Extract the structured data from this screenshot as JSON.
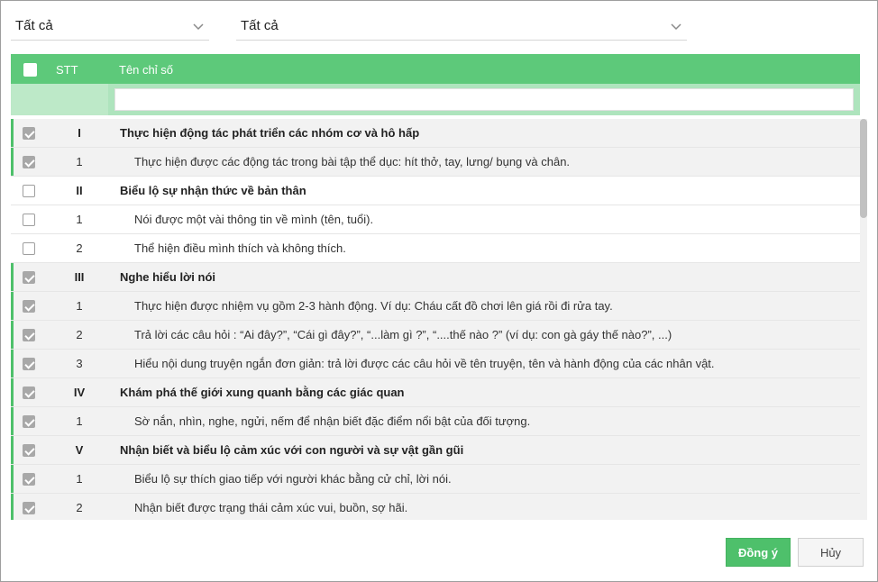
{
  "filters": {
    "first": {
      "value": "Tất cả"
    },
    "second": {
      "value": "Tất cả"
    }
  },
  "table": {
    "columns": {
      "stt": "STT",
      "name": "Tên chỉ số"
    },
    "filter_placeholder": "",
    "rows": [
      {
        "stt": "I",
        "name": "Thực hiện động tác phát triển các nhóm cơ và hô hấp",
        "group": true,
        "checked": true
      },
      {
        "stt": "1",
        "name": "Thực hiện được các động tác trong bài tập thể dục: hít thở, tay, lưng/ bụng và chân.",
        "group": false,
        "checked": true
      },
      {
        "stt": "II",
        "name": "Biểu lộ sự nhận thức về bản thân",
        "group": true,
        "checked": false
      },
      {
        "stt": "1",
        "name": "Nói được một vài thông tin về mình (tên, tuổi).",
        "group": false,
        "checked": false
      },
      {
        "stt": "2",
        "name": "Thể hiện điều mình thích và không thích.",
        "group": false,
        "checked": false
      },
      {
        "stt": "III",
        "name": "Nghe hiểu lời nói",
        "group": true,
        "checked": true
      },
      {
        "stt": "1",
        "name": "Thực hiện được nhiệm vụ gồm 2-3 hành động. Ví dụ: Cháu cất đồ chơi lên giá rồi đi rửa tay.",
        "group": false,
        "checked": true
      },
      {
        "stt": "2",
        "name": "Trả lời các câu hỏi : “Ai đây?”, “Cái gì đây?”, “...làm gì ?”, “....thế nào ?” (ví dụ: con gà gáy thế nào?”, ...)",
        "group": false,
        "checked": true
      },
      {
        "stt": "3",
        "name": "Hiểu nội dung truyện ngắn đơn giản: trả lời được các câu hỏi về tên truyện, tên và hành động của các nhân vật.",
        "group": false,
        "checked": true
      },
      {
        "stt": "IV",
        "name": "Khám phá thế giới xung quanh bằng các giác quan",
        "group": true,
        "checked": true
      },
      {
        "stt": "1",
        "name": "Sờ nắn, nhìn, nghe, ngửi, nếm để nhận biết đặc điểm nổi bật của đối tượng.",
        "group": false,
        "checked": true
      },
      {
        "stt": "V",
        "name": "Nhận biết và biểu lộ cảm xúc với con người và sự vật gần gũi",
        "group": true,
        "checked": true
      },
      {
        "stt": "1",
        "name": "Biểu lộ sự thích giao tiếp với người khác bằng cử chỉ, lời nói.",
        "group": false,
        "checked": true
      },
      {
        "stt": "2",
        "name": "Nhận biết được trạng thái cảm xúc vui, buồn, sợ hãi.",
        "group": false,
        "checked": true
      }
    ]
  },
  "buttons": {
    "ok": "Đồng ý",
    "cancel": "Hủy"
  },
  "colors": {
    "accent": "#5dc97a",
    "selected_bar": "#4ec06b",
    "checked_box": "#a8a8a8"
  },
  "icons": {
    "dropdown": "chevron-down-icon",
    "checkbox": "checkbox-icon"
  }
}
